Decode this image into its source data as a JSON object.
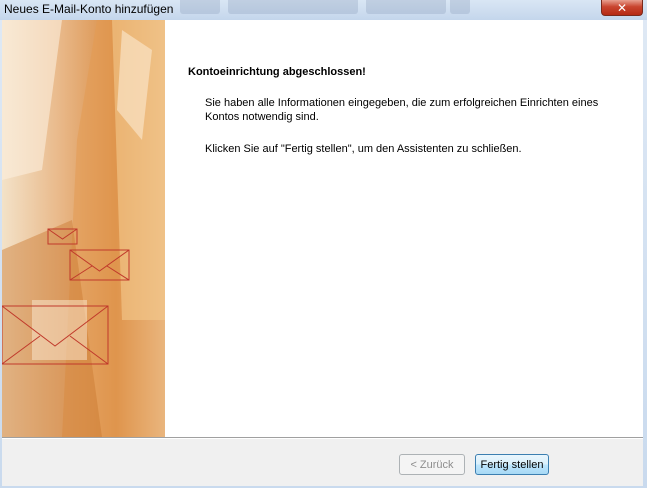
{
  "window": {
    "title": "Neues E-Mail-Konto hinzufügen",
    "close_glyph": "✕"
  },
  "content": {
    "heading": "Kontoeinrichtung abgeschlossen!",
    "paragraph1": "Sie haben alle Informationen eingegeben, die zum erfolgreichen Einrichten eines Kontos notwendig sind.",
    "paragraph2": "Klicken Sie auf \"Fertig stellen\", um den Assistenten zu schließen."
  },
  "buttons": {
    "back_label": "< Zurück",
    "finish_label": "Fertig stellen"
  },
  "colors": {
    "banner_accent": "#d98e47",
    "envelope_stroke": "#c0392b",
    "finish_button_border": "#3c7fb1"
  }
}
